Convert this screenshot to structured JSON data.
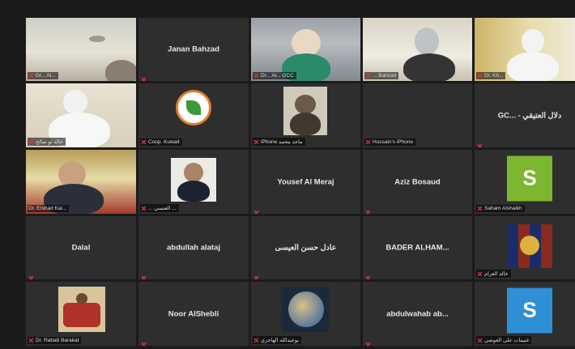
{
  "tiles": [
    {
      "id": "t1",
      "name": "Dr... Al...",
      "kind": "video"
    },
    {
      "id": "t2",
      "name": "Janan Bahzad",
      "kind": "name"
    },
    {
      "id": "t3",
      "name": "Dr... Al... GCC",
      "kind": "video"
    },
    {
      "id": "t4",
      "name": "... Bahzad",
      "kind": "video"
    },
    {
      "id": "t5",
      "name": "Dr. Kh...",
      "kind": "video"
    },
    {
      "id": "t6",
      "name": "خالد بو صالح",
      "kind": "video"
    },
    {
      "id": "t7",
      "name": "Coop. Kuwait",
      "kind": "logo"
    },
    {
      "id": "t8",
      "name": "iPhone ماجد محمد",
      "kind": "video"
    },
    {
      "id": "t9",
      "name": "Hussain's iPhone",
      "kind": "empty"
    },
    {
      "id": "t10",
      "name": "GC... - دلال العتيقي",
      "kind": "name"
    },
    {
      "id": "t11",
      "name": "Dr. Ershad Kal...",
      "kind": "video"
    },
    {
      "id": "t12",
      "name": "... العنسي ...",
      "kind": "photo"
    },
    {
      "id": "t13",
      "name": "Yousef Al Meraj",
      "kind": "name"
    },
    {
      "id": "t14",
      "name": "Aziz Bosaud",
      "kind": "name"
    },
    {
      "id": "t15",
      "name": "Saham Alshaikh",
      "kind": "avatar",
      "initial": "S"
    },
    {
      "id": "t16",
      "name": "Dalal",
      "kind": "name"
    },
    {
      "id": "t17",
      "name": "abdullah alataj",
      "kind": "name"
    },
    {
      "id": "t18",
      "name": "عادل حسن العيسى",
      "kind": "name"
    },
    {
      "id": "t19",
      "name": "BADER ALHAM...",
      "kind": "name"
    },
    {
      "id": "t20",
      "name": "خالد العرام",
      "kind": "photo"
    },
    {
      "id": "t21",
      "name": "Dr. Rabab Barakat",
      "kind": "photo"
    },
    {
      "id": "t22",
      "name": "Noor AlShebli",
      "kind": "name"
    },
    {
      "id": "t23",
      "name": "بوعبدالله الهاجري",
      "kind": "photo"
    },
    {
      "id": "t24",
      "name": "abdulwahab ab...",
      "kind": "name"
    },
    {
      "id": "t25",
      "name": "غنيمات على العوضي",
      "kind": "avatar",
      "initial": "S"
    }
  ],
  "colors": {
    "tile_bg": "#2e2e2e",
    "mute_red": "#e0362c",
    "active_border": "#c8d63a",
    "avatar_green": "#7db72f",
    "avatar_blue": "#2f8fd6"
  }
}
